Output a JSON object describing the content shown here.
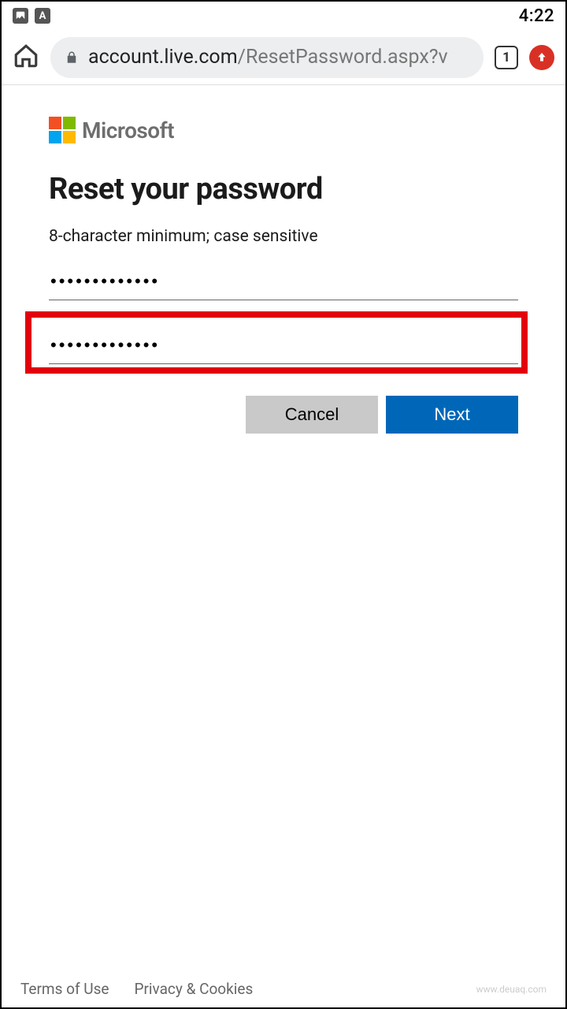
{
  "status_bar": {
    "time": "4:22"
  },
  "browser": {
    "url_host": "account.live.com",
    "url_path": "/ResetPassword.aspx?v",
    "tab_count": "1"
  },
  "page": {
    "brand": "Microsoft",
    "title": "Reset your password",
    "hint": "8-character minimum; case sensitive",
    "password_value": "•••••••••••••",
    "confirm_value": "•••••••••••••",
    "cancel_label": "Cancel",
    "next_label": "Next"
  },
  "footer": {
    "terms": "Terms of Use",
    "privacy": "Privacy & Cookies",
    "watermark": "www.deuaq.com"
  }
}
